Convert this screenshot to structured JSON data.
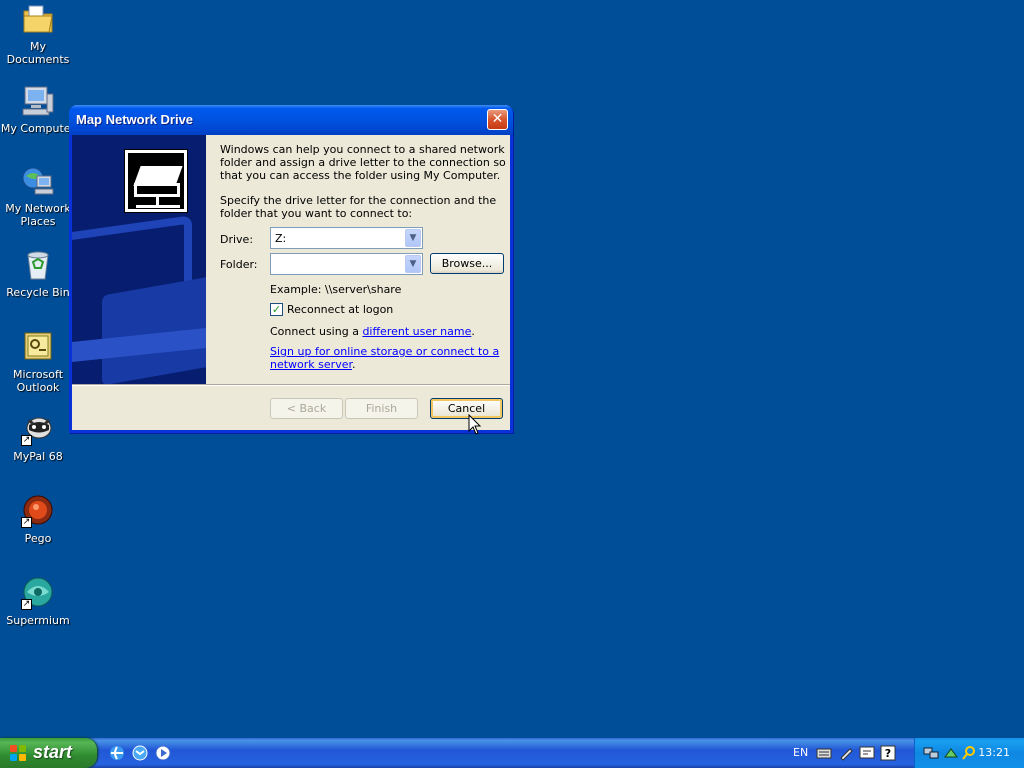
{
  "desktop": {
    "icons": [
      {
        "label": "My Documents",
        "icon": "my-documents-folder-icon"
      },
      {
        "label": "My Computer",
        "icon": "my-computer-icon"
      },
      {
        "label": "My Network Places",
        "icon": "network-places-icon"
      },
      {
        "label": "Recycle Bin",
        "icon": "recycle-bin-icon"
      },
      {
        "label": "Microsoft Outlook",
        "icon": "outlook-icon"
      },
      {
        "label": "MyPal 68",
        "icon": "mypal-icon"
      },
      {
        "label": "Pego",
        "icon": "pego-icon"
      },
      {
        "label": "Supermium",
        "icon": "supermium-icon"
      }
    ]
  },
  "dialog": {
    "title": "Map Network Drive",
    "intro": "Windows can help you connect to a shared network folder and assign a drive letter to the connection so that you can access the folder using My Computer.",
    "instructions": "Specify the drive letter for the connection and the folder that you want to connect to:",
    "drive_label": "Drive:",
    "drive_value": "Z:",
    "folder_label": "Folder:",
    "folder_value": "",
    "browse_label": "Browse...",
    "example": "Example: \\\\server\\share",
    "reconnect_label": "Reconnect at logon",
    "reconnect_checked": true,
    "connect_using_prefix": "Connect using a ",
    "connect_using_link": "different user name",
    "connect_using_suffix": ".",
    "signup_link": "Sign up for online storage or connect to a network server",
    "signup_suffix": ".",
    "back_label": "< Back",
    "finish_label": "Finish",
    "cancel_label": "Cancel",
    "close_glyph": "✕"
  },
  "taskbar": {
    "start_label": "start",
    "language": "EN",
    "clock": "13:21"
  },
  "colors": {
    "desktop_bg": "#004e98",
    "titlebar": "#0054e3",
    "dialog_bg": "#ece9d8",
    "link": "#0000ff",
    "start_green": "#3c9a3c"
  }
}
